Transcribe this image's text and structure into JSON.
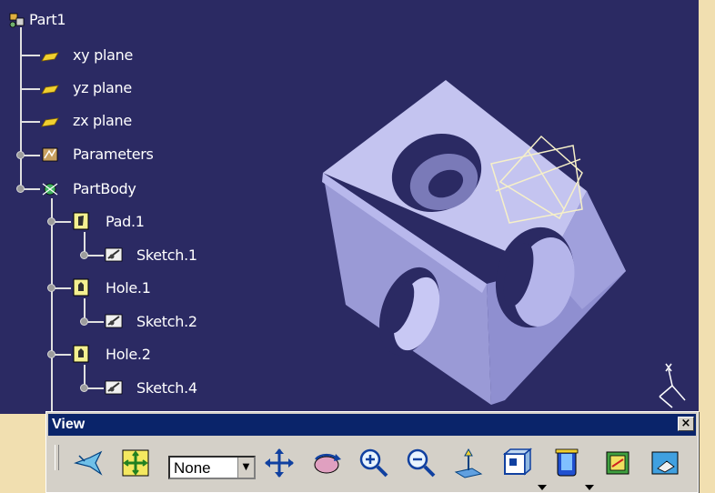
{
  "tree": {
    "root": "Part1",
    "nodes": [
      {
        "label": "xy plane",
        "icon": "plane-icon"
      },
      {
        "label": "yz plane",
        "icon": "plane-icon"
      },
      {
        "label": "zx plane",
        "icon": "plane-icon"
      },
      {
        "label": "Parameters",
        "icon": "parameters-icon"
      },
      {
        "label": "PartBody",
        "icon": "partbody-icon"
      },
      {
        "label": "Pad.1",
        "icon": "pad-icon"
      },
      {
        "label": "Sketch.1",
        "icon": "sketch-icon"
      },
      {
        "label": "Hole.1",
        "icon": "hole-icon"
      },
      {
        "label": "Sketch.2",
        "icon": "sketch-icon"
      },
      {
        "label": "Hole.2",
        "icon": "hole-icon"
      },
      {
        "label": "Sketch.4",
        "icon": "sketch-icon"
      }
    ]
  },
  "toolbar": {
    "title": "View",
    "close": "×",
    "render_select_value": "None",
    "select_arrow": "▼",
    "buttons": [
      "fly-mode-icon",
      "fit-all-in-icon",
      "pan-icon",
      "rotate-icon",
      "zoom-in-icon",
      "zoom-out-icon",
      "normal-view-icon",
      "multi-view-icon",
      "quick-view-icon",
      "hide-show-icon",
      "swap-visible-space-icon"
    ]
  },
  "colors": {
    "viewport": "#2b2a63",
    "part": "#a9a9e4",
    "frame": "#f1dfb0",
    "titlebar": "#0a246a"
  }
}
